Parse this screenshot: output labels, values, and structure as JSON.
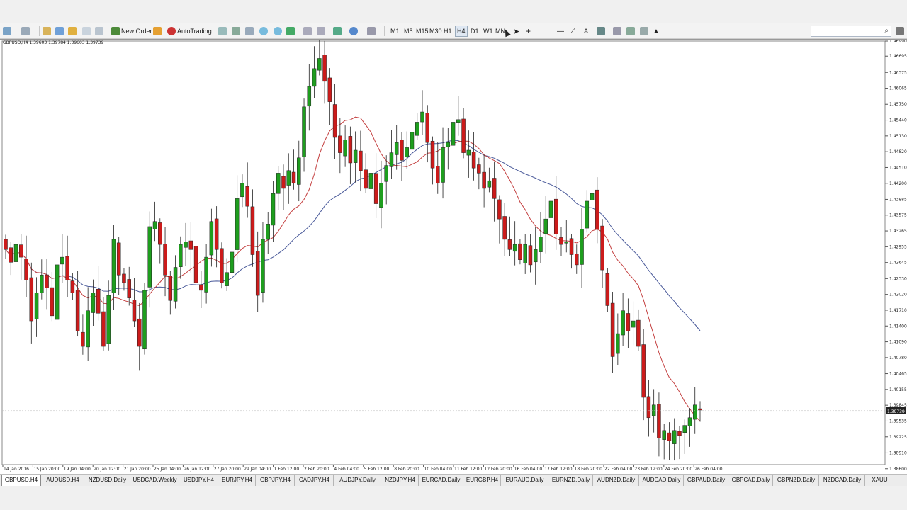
{
  "toolbar": {
    "new_order": "New Order",
    "auto_trading": "AutoTrading",
    "timeframes": [
      "M1",
      "M5",
      "M15",
      "M30",
      "H1",
      "H4",
      "D1",
      "W1",
      "MN"
    ]
  },
  "chart": {
    "header": "GBPUSD,H4  1.39603 1.39784 1.39603 1.39739",
    "current_price": "1.39739"
  },
  "chart_data": {
    "type": "candlestick",
    "symbol": "GBPUSD",
    "timeframe": "H4",
    "colors": {
      "bull": "#1e9e1e",
      "bear": "#cc1b1b",
      "ma_fast": "#c44040",
      "ma_slow": "#4a5a9a"
    },
    "ylim": [
      1.3868,
      1.4699
    ],
    "y_ticks": [
      "1.46990",
      "1.46695",
      "1.46375",
      "1.46065",
      "1.45750",
      "1.45440",
      "1.45130",
      "1.44820",
      "1.44510",
      "1.44200",
      "1.43885",
      "1.43575",
      "1.43265",
      "1.42955",
      "1.42645",
      "1.42330",
      "1.42020",
      "1.41710",
      "1.41400",
      "1.41090",
      "1.40780",
      "1.40465",
      "1.40155",
      "1.39845",
      "1.39535",
      "1.39225",
      "1.38910",
      "1.38600"
    ],
    "x_labels": [
      "14 Jan 2016",
      "15 Jan 20:00",
      "19 Jan 04:00",
      "20 Jan 12:00",
      "21 Jan 20:00",
      "25 Jan 04:00",
      "26 Jan 12:00",
      "27 Jan 20:00",
      "29 Jan 04:00",
      "1 Feb 12:00",
      "2 Feb 20:00",
      "4 Feb 04:00",
      "5 Feb 12:00",
      "8 Feb 20:00",
      "10 Feb 04:00",
      "11 Feb 12:00",
      "12 Feb 20:00",
      "16 Feb 04:00",
      "17 Feb 12:00",
      "18 Feb 20:00",
      "22 Feb 04:00",
      "23 Feb 12:00",
      "24 Feb 20:00",
      "26 Feb 04:00"
    ],
    "closes": [
      1.429,
      1.4265,
      1.43,
      1.4275,
      1.423,
      1.415,
      1.4205,
      1.424,
      1.4215,
      1.416,
      1.426,
      1.4275,
      1.423,
      1.4205,
      1.413,
      1.41,
      1.417,
      1.4205,
      1.4165,
      1.41,
      1.42,
      1.431,
      1.424,
      1.4225,
      1.4195,
      1.415,
      1.41,
      1.421,
      1.4335,
      1.4345,
      1.43,
      1.424,
      1.419,
      1.4255,
      1.43,
      1.4305,
      1.429,
      1.4225,
      1.421,
      1.4275,
      1.4345,
      1.429,
      1.4225,
      1.4245,
      1.4285,
      1.439,
      1.442,
      1.4375,
      1.428,
      1.42,
      1.431,
      1.434,
      1.44,
      1.444,
      1.441,
      1.4445,
      1.442,
      1.447,
      1.457,
      1.461,
      1.4645,
      1.4665,
      1.462,
      1.458,
      1.451,
      1.448,
      1.4505,
      1.446,
      1.4485,
      1.4445,
      1.441,
      1.444,
      1.438,
      1.442,
      1.4455,
      1.448,
      1.45,
      1.4465,
      1.449,
      1.452,
      1.454,
      1.456,
      1.45,
      1.445,
      1.442,
      1.449,
      1.45,
      1.454,
      1.4545,
      1.448,
      1.4485,
      1.445,
      1.444,
      1.441,
      1.4425,
      1.439,
      1.435,
      1.431,
      1.429,
      1.43,
      1.427,
      1.43,
      1.426,
      1.429,
      1.4315,
      1.435,
      1.4385,
      1.432,
      1.43,
      1.4305,
      1.428,
      1.426,
      1.433,
      1.4385,
      1.44,
      1.433,
      1.425,
      1.418,
      1.408,
      1.4125,
      1.417,
      1.413,
      1.415,
      1.41,
      1.4,
      1.396,
      1.3985,
      1.392,
      1.3935,
      1.3915,
      1.3935,
      1.3925,
      1.3945,
      1.396,
      1.3985,
      1.3975
    ]
  },
  "tabs": [
    "GBPUSD,H4",
    "AUDUSD,H4",
    "NZDUSD,Daily",
    "USDCAD,Weekly",
    "USDJPY,H4",
    "EURJPY,H4",
    "GBPJPY,H4",
    "CADJPY,H4",
    "AUDJPY,Daily",
    "NZDJPY,H4",
    "EURCAD,Daily",
    "EURGBP,H4",
    "EURAUD,Daily",
    "EURNZD,Daily",
    "AUDNZD,Daily",
    "AUDCAD,Daily",
    "GBPAUD,Daily",
    "GBPCAD,Daily",
    "GBPNZD,Daily",
    "NZDCAD,Daily",
    "XAUU"
  ]
}
